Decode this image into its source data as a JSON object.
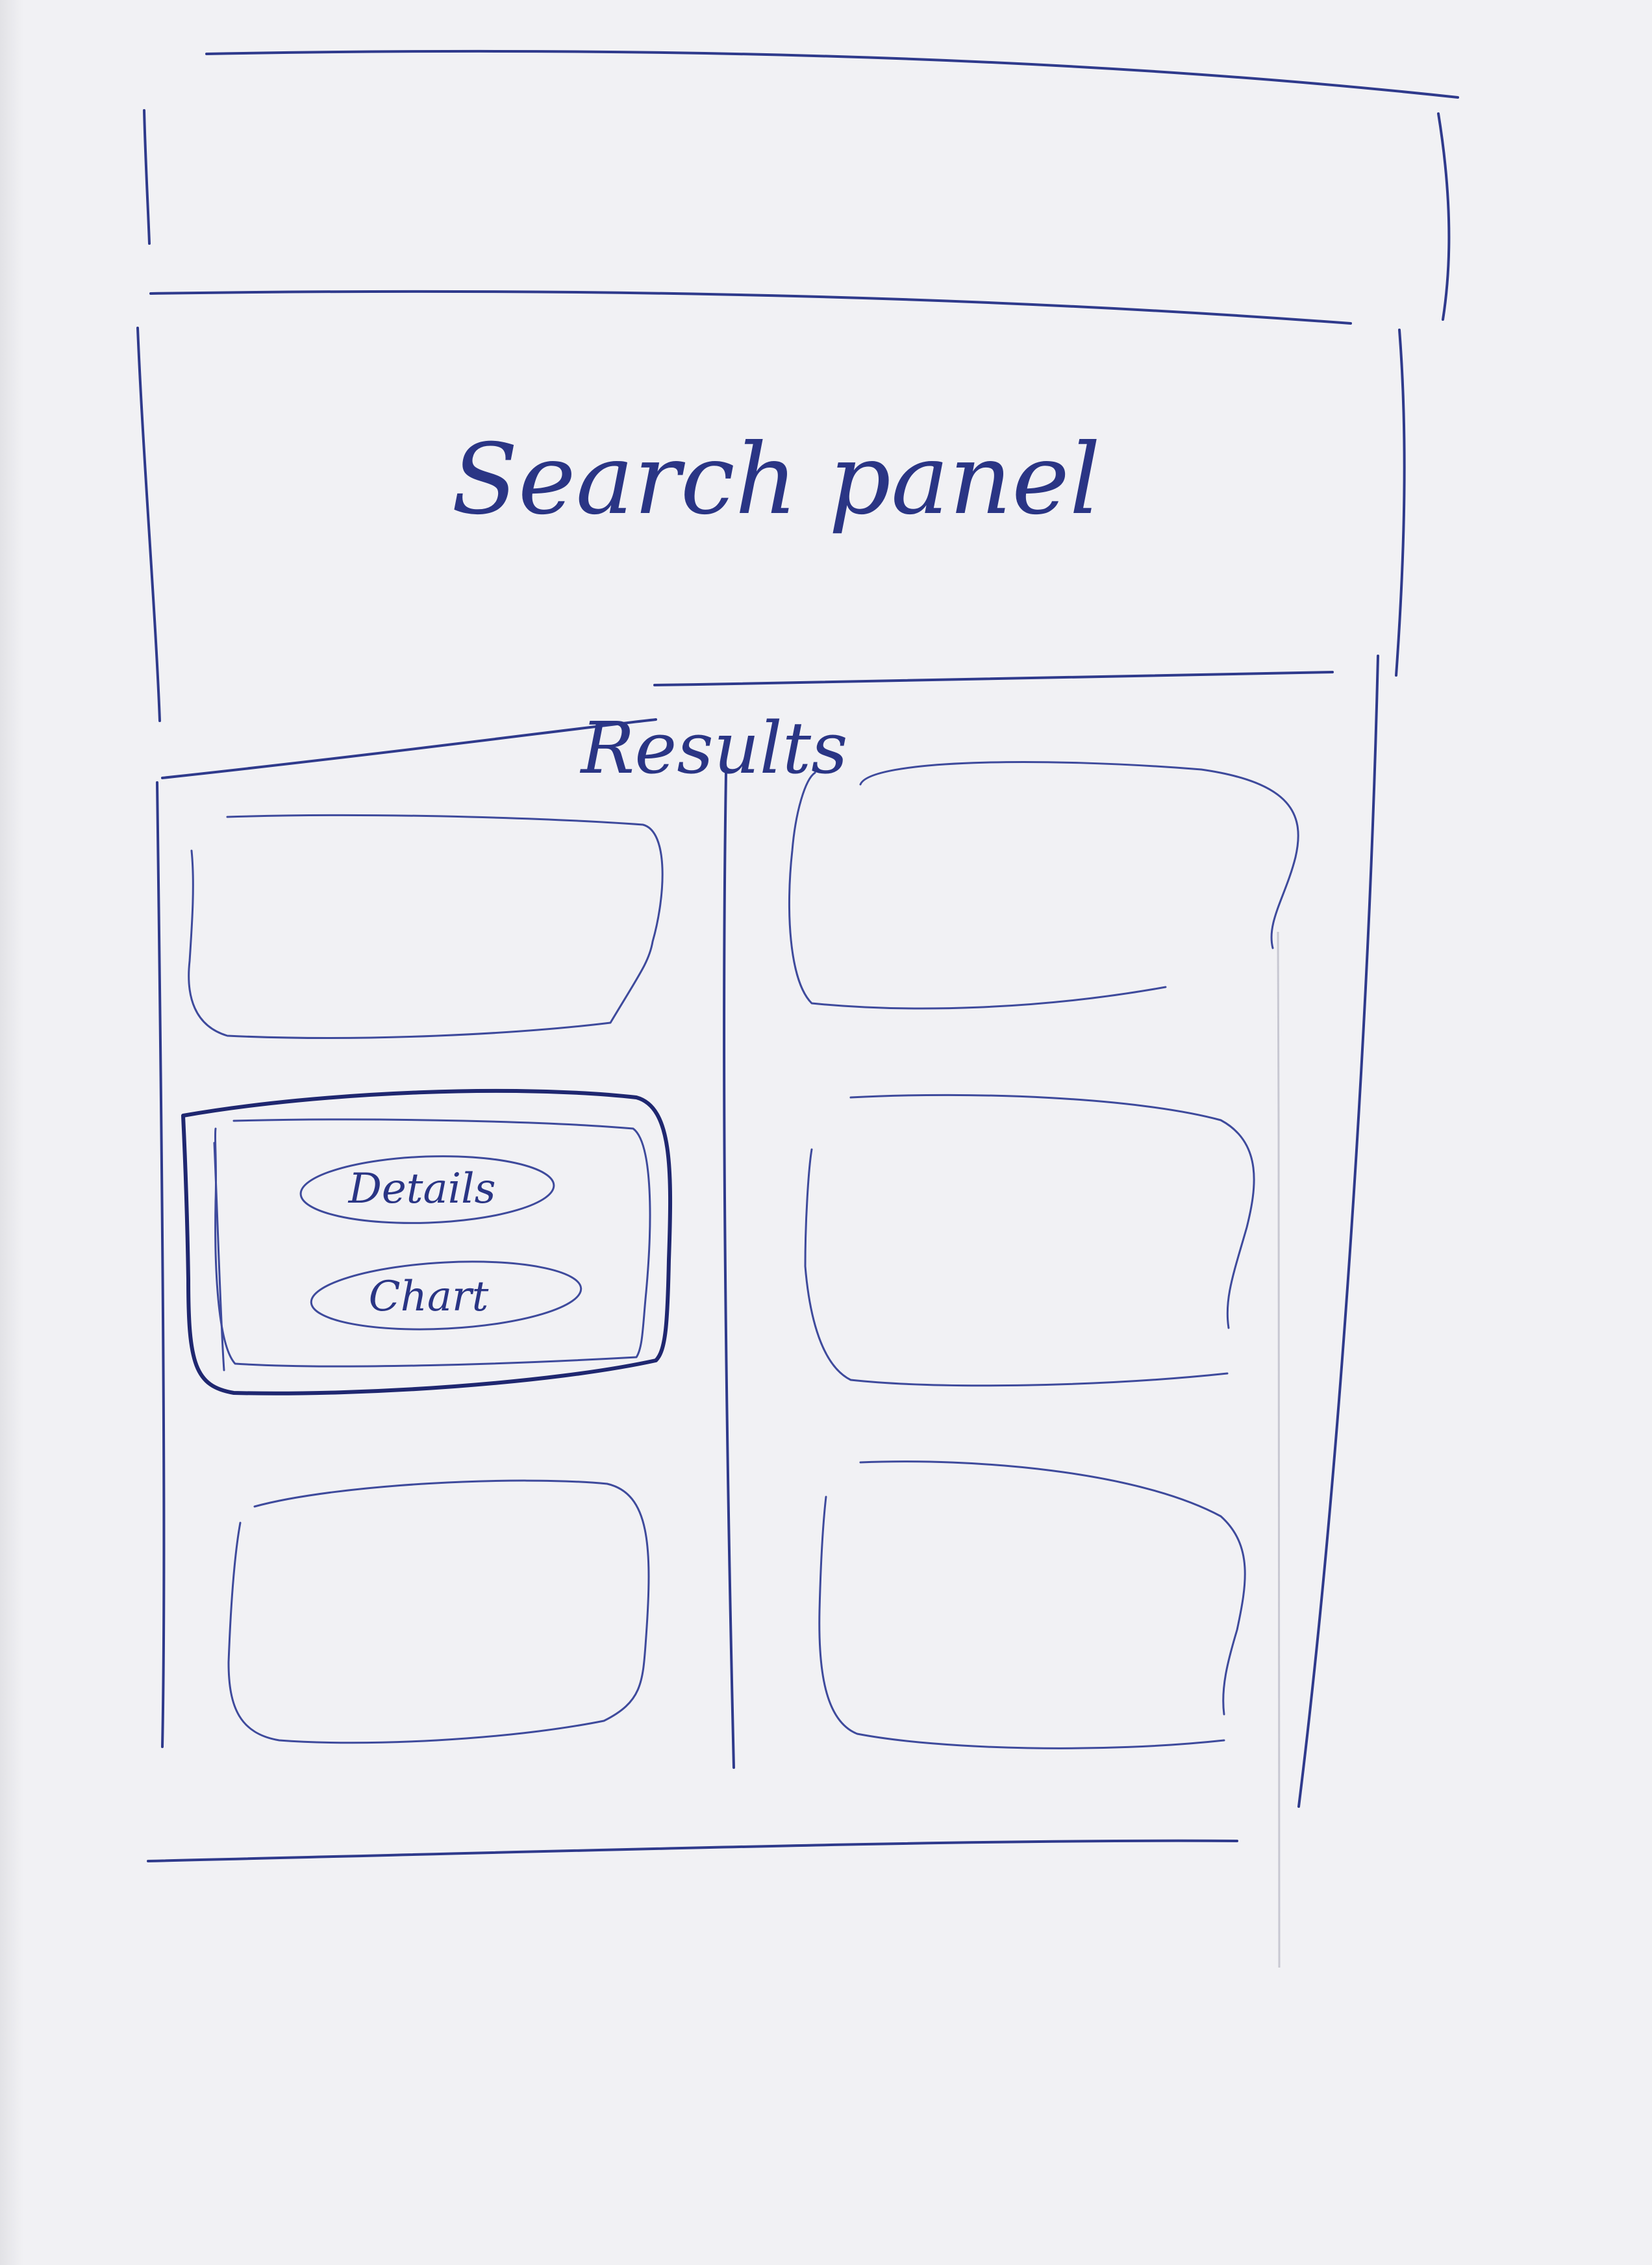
{
  "search_panel": {
    "label": "Search panel"
  },
  "results": {
    "label": "Results"
  },
  "selected_card": {
    "details_button": "Details",
    "chart_button": "Chart"
  },
  "ink_color": "#2f3a8c",
  "paper_color": "#f1f1f4"
}
